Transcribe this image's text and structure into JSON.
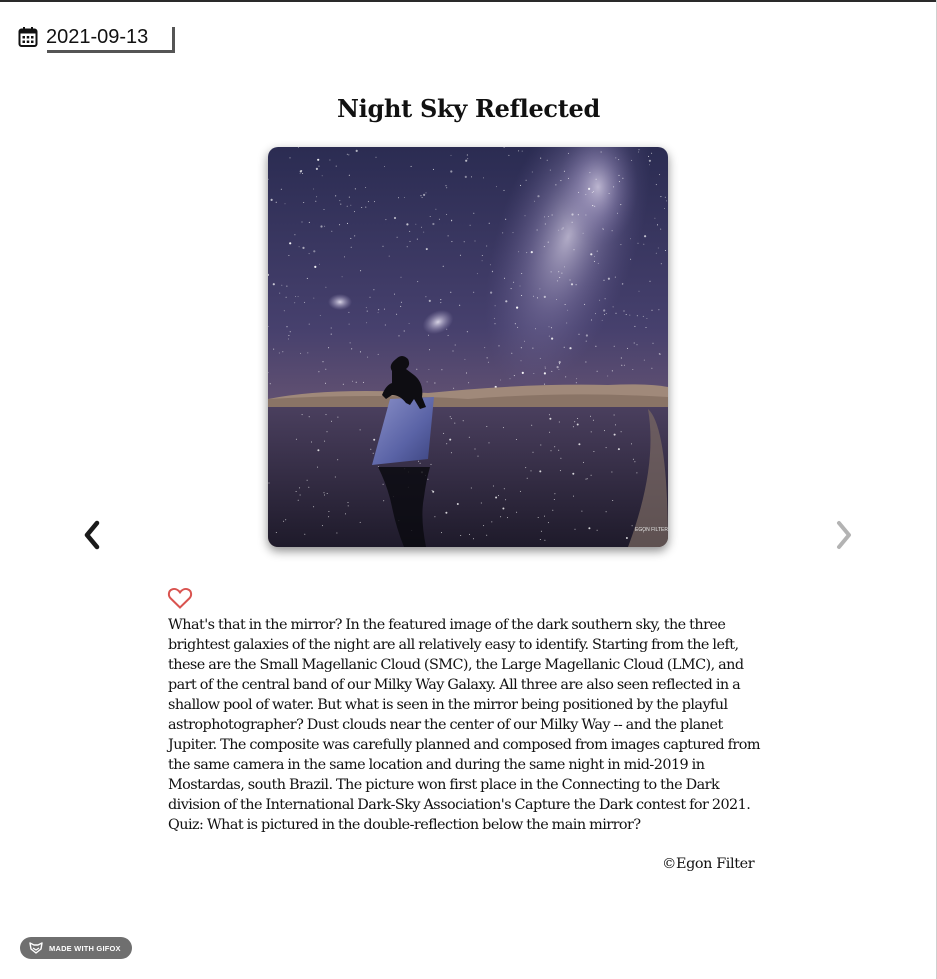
{
  "date_picker": {
    "value": "2021-09-13",
    "icon": "calendar-icon"
  },
  "apod": {
    "title": "Night Sky Reflected",
    "image_alt": "Night Sky Reflected",
    "description": "What's that in the mirror? In the featured image of the dark southern sky, the three brightest galaxies of the night are all relatively easy to identify. Starting from the left, these are the Small Magellanic Cloud (SMC), the Large Magellanic Cloud (LMC), and part of the central band of our Milky Way Galaxy. All three are also seen reflected in a shallow pool of water. But what is seen in the mirror being positioned by the playful astrophotographer? Dust clouds near the center of our Milky Way -- and the planet Jupiter. The composite was carefully planned and composed from images captured from the same camera in the same location and during the same night in mid-2019 in Mostardas, south Brazil. The picture won first place in the Connecting to the Dark division of the International Dark-Sky Association's Capture the Dark contest for 2021. Quiz: What is pictured in the double-reflection below the main mirror?",
    "credit": "©Egon Filter"
  },
  "navigation": {
    "prev_icon": "chevron-left-icon",
    "next_icon": "chevron-right-icon",
    "prev_color": "#1a1a1a",
    "next_color": "#b3b3b3"
  },
  "favorite": {
    "icon": "heart-outline-icon",
    "color": "#d9534f"
  },
  "badge": {
    "label": "MADE WITH GIFOX",
    "icon": "fox-icon",
    "background": "#6f6f6f"
  }
}
